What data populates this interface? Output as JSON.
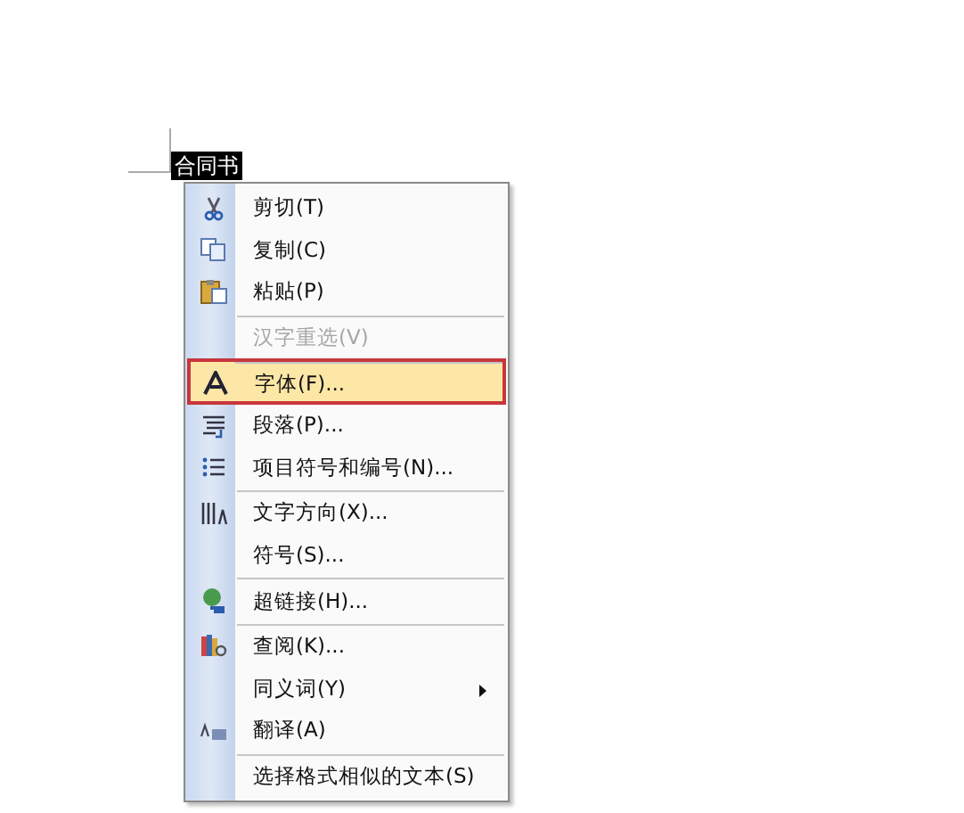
{
  "document": {
    "selected_text": "合同书"
  },
  "menu": {
    "items": [
      {
        "label": "剪切(T)",
        "separator_before": false,
        "disabled": false,
        "selected": false,
        "submenu": false
      },
      {
        "label": "复制(C)",
        "separator_before": false,
        "disabled": false,
        "selected": false,
        "submenu": false
      },
      {
        "label": "粘贴(P)",
        "separator_before": false,
        "disabled": false,
        "selected": false,
        "submenu": false
      },
      {
        "label": "汉字重选(V)",
        "separator_before": true,
        "disabled": true,
        "selected": false,
        "submenu": false
      },
      {
        "label": "字体(F)...",
        "separator_before": true,
        "disabled": false,
        "selected": true,
        "submenu": false
      },
      {
        "label": "段落(P)...",
        "separator_before": false,
        "disabled": false,
        "selected": false,
        "submenu": false
      },
      {
        "label": "项目符号和编号(N)...",
        "separator_before": false,
        "disabled": false,
        "selected": false,
        "submenu": false
      },
      {
        "label": "文字方向(X)...",
        "separator_before": true,
        "disabled": false,
        "selected": false,
        "submenu": false
      },
      {
        "label": "符号(S)...",
        "separator_before": false,
        "disabled": false,
        "selected": false,
        "submenu": false
      },
      {
        "label": "超链接(H)...",
        "separator_before": true,
        "disabled": false,
        "selected": false,
        "submenu": false
      },
      {
        "label": "查阅(K)...",
        "separator_before": true,
        "disabled": false,
        "selected": false,
        "submenu": false
      },
      {
        "label": "同义词(Y)",
        "separator_before": false,
        "disabled": false,
        "selected": false,
        "submenu": true
      },
      {
        "label": "翻译(A)",
        "separator_before": false,
        "disabled": false,
        "selected": false,
        "submenu": false
      },
      {
        "label": "选择格式相似的文本(S)",
        "separator_before": true,
        "disabled": false,
        "selected": false,
        "submenu": false
      }
    ]
  }
}
